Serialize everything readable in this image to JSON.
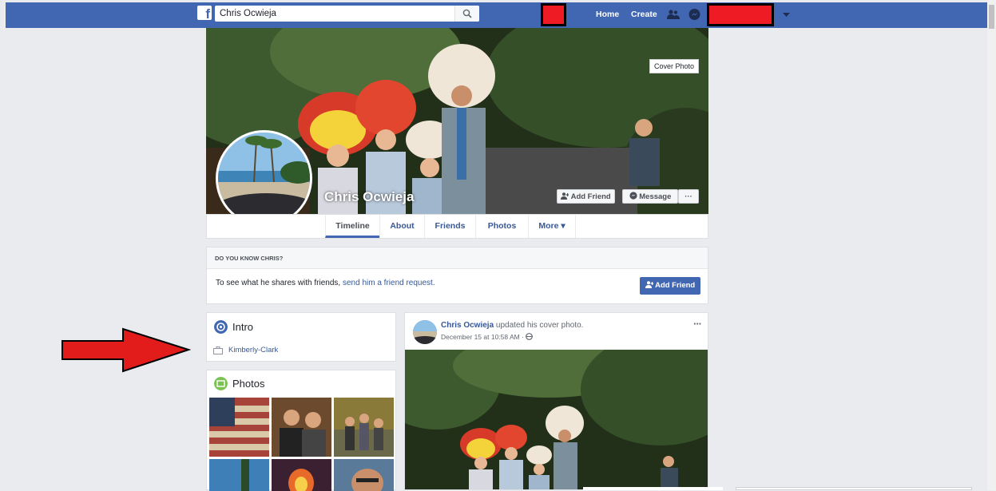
{
  "topbar": {
    "logo": "f",
    "search_value": "Chris Ocwieja",
    "home_label": "Home",
    "create_label": "Create",
    "brand_color": "#4267b2"
  },
  "cover": {
    "label": "Cover Photo"
  },
  "profile": {
    "name": "Chris Ocwieja",
    "add_friend_label": "Add Friend",
    "message_label": "Message",
    "more_label": "···"
  },
  "tabs": [
    {
      "label": "Timeline"
    },
    {
      "label": "About"
    },
    {
      "label": "Friends"
    },
    {
      "label": "Photos"
    },
    {
      "label": "More ▾"
    }
  ],
  "know": {
    "heading": "DO YOU KNOW CHRIS?",
    "text": "To see what he shares with friends, ",
    "link": "send him a friend request.",
    "button_label": "Add Friend"
  },
  "intro": {
    "title": "Intro",
    "employer": "Kimberly-Clark"
  },
  "photos": {
    "title": "Photos"
  },
  "post": {
    "author": "Chris Ocwieja",
    "action": " updated his cover photo.",
    "date": "December 15 at 10:58 AM · ",
    "more": "···"
  },
  "icons": [
    "search-icon",
    "friends-icon",
    "messenger-icon",
    "chevron-down-icon",
    "add-friend-icon",
    "messenger-small-icon",
    "globe-icon",
    "intro-icon",
    "briefcase-icon",
    "photos-icon",
    "red-arrow"
  ]
}
